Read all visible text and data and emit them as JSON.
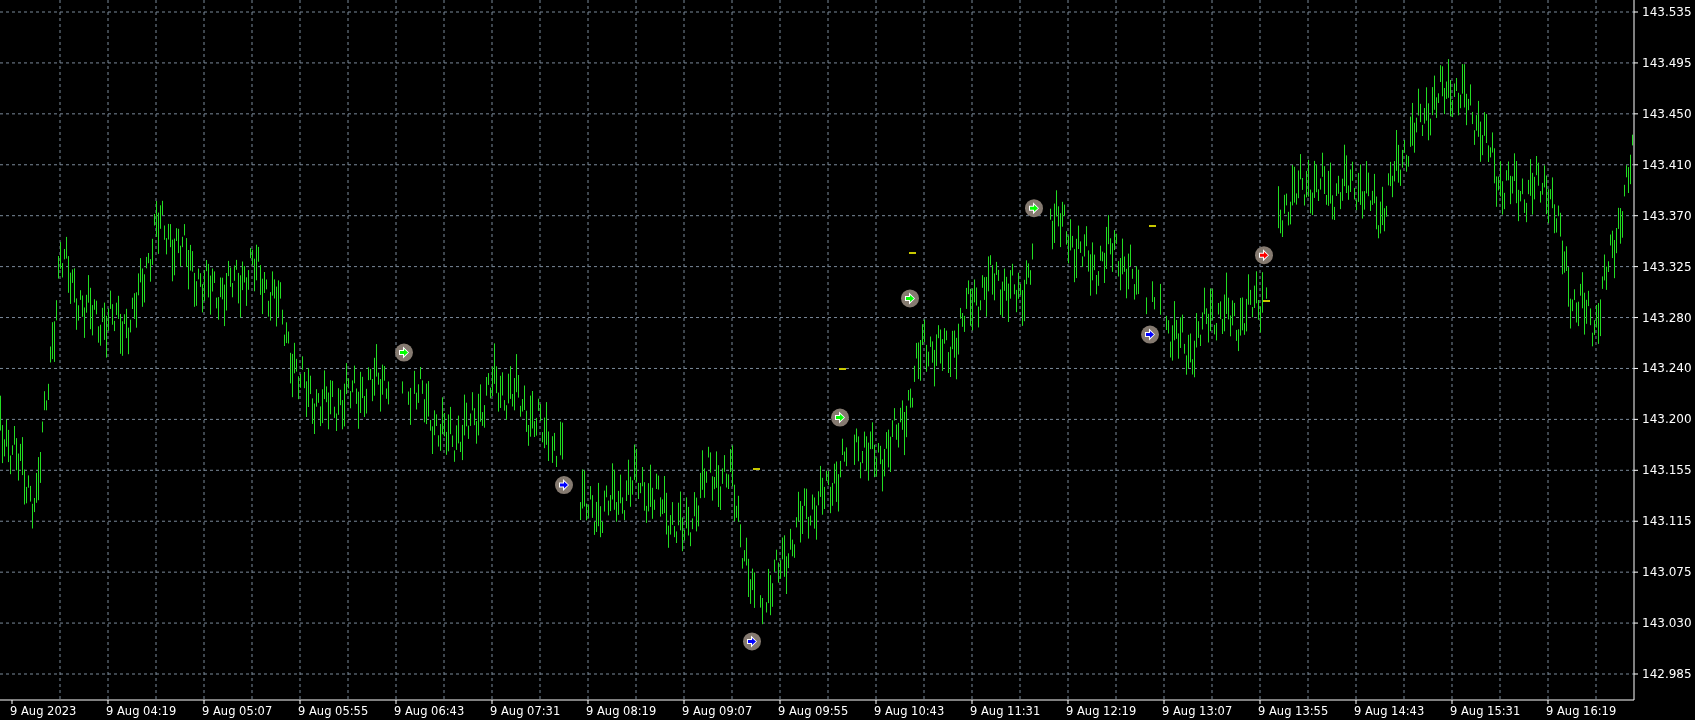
{
  "chart": {
    "y_axis": {
      "labels": [
        "143.535",
        "143.495",
        "143.450",
        "143.410",
        "143.370",
        "143.325",
        "143.280",
        "143.240",
        "143.200",
        "143.155",
        "143.115",
        "143.075",
        "143.030",
        "142.985"
      ]
    },
    "x_axis": {
      "labels": [
        "9 Aug 2023",
        "9 Aug 04:19",
        "9 Aug 05:07",
        "9 Aug 05:55",
        "9 Aug 06:43",
        "9 Aug 07:31",
        "9 Aug 08:19",
        "9 Aug 09:07",
        "9 Aug 09:55",
        "9 Aug 10:43",
        "9 Aug 11:31",
        "9 Aug 12:19",
        "9 Aug 13:07",
        "9 Aug 13:55",
        "9 Aug 14:43",
        "9 Aug 15:31",
        "9 Aug 16:19"
      ]
    },
    "markers": [
      {
        "kind": "arrow",
        "color": "#00ff00"
      },
      {
        "kind": "arrow",
        "color": "#0000ff"
      },
      {
        "kind": "arrow",
        "color": "#0000ff"
      },
      {
        "kind": "arrow",
        "color": "#00ff00"
      },
      {
        "kind": "arrow",
        "color": "#00ff00"
      },
      {
        "kind": "arrow",
        "color": "#00ff00"
      },
      {
        "kind": "arrow",
        "color": "#0000ff"
      },
      {
        "kind": "arrow",
        "color": "#ff0000"
      },
      {
        "kind": "dash",
        "color": "#c8c800"
      },
      {
        "kind": "dash",
        "color": "#c8c800"
      },
      {
        "kind": "dash",
        "color": "#c8c800"
      },
      {
        "kind": "dash",
        "color": "#c8c800"
      },
      {
        "kind": "dash",
        "color": "#c8c800"
      }
    ]
  }
}
